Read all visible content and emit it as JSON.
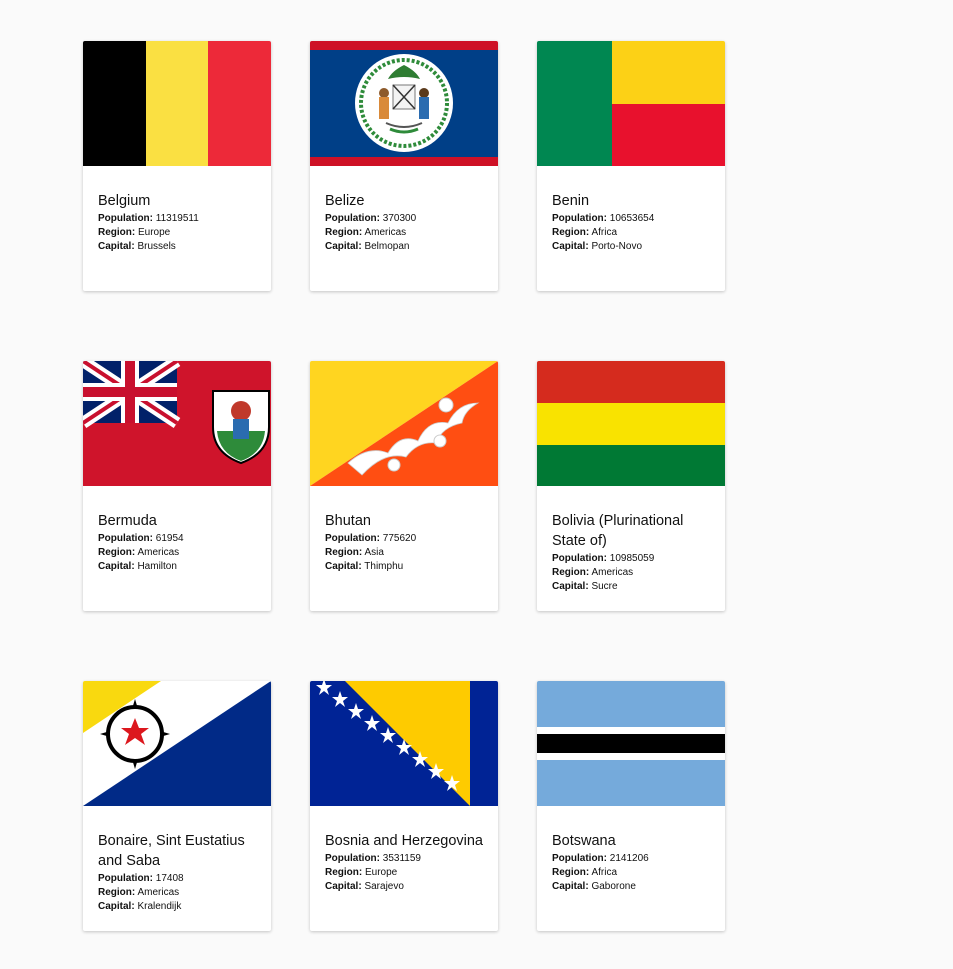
{
  "field_labels": {
    "population": "Population:",
    "region": "Region:",
    "capital": "Capital:"
  },
  "countries": [
    {
      "name": "Belgium",
      "population": "11319511",
      "region": "Europe",
      "capital": "Brussels",
      "flag_icon": "belgium-flag-icon"
    },
    {
      "name": "Belize",
      "population": "370300",
      "region": "Americas",
      "capital": "Belmopan",
      "flag_icon": "belize-flag-icon"
    },
    {
      "name": "Benin",
      "population": "10653654",
      "region": "Africa",
      "capital": "Porto-Novo",
      "flag_icon": "benin-flag-icon"
    },
    {
      "name": "Bermuda",
      "population": "61954",
      "region": "Americas",
      "capital": "Hamilton",
      "flag_icon": "bermuda-flag-icon"
    },
    {
      "name": "Bhutan",
      "population": "775620",
      "region": "Asia",
      "capital": "Thimphu",
      "flag_icon": "bhutan-flag-icon"
    },
    {
      "name": "Bolivia (Plurinational State of)",
      "population": "10985059",
      "region": "Americas",
      "capital": "Sucre",
      "flag_icon": "bolivia-flag-icon"
    },
    {
      "name": "Bonaire, Sint Eustatius and Saba",
      "population": "17408",
      "region": "Americas",
      "capital": "Kralendijk",
      "flag_icon": "bonaire-flag-icon"
    },
    {
      "name": "Bosnia and Herzegovina",
      "population": "3531159",
      "region": "Europe",
      "capital": "Sarajevo",
      "flag_icon": "bosnia-herzegovina-flag-icon"
    },
    {
      "name": "Botswana",
      "population": "2141206",
      "region": "Africa",
      "capital": "Gaborone",
      "flag_icon": "botswana-flag-icon"
    }
  ],
  "colors": {
    "background": "#fafafa",
    "card": "#ffffff"
  }
}
